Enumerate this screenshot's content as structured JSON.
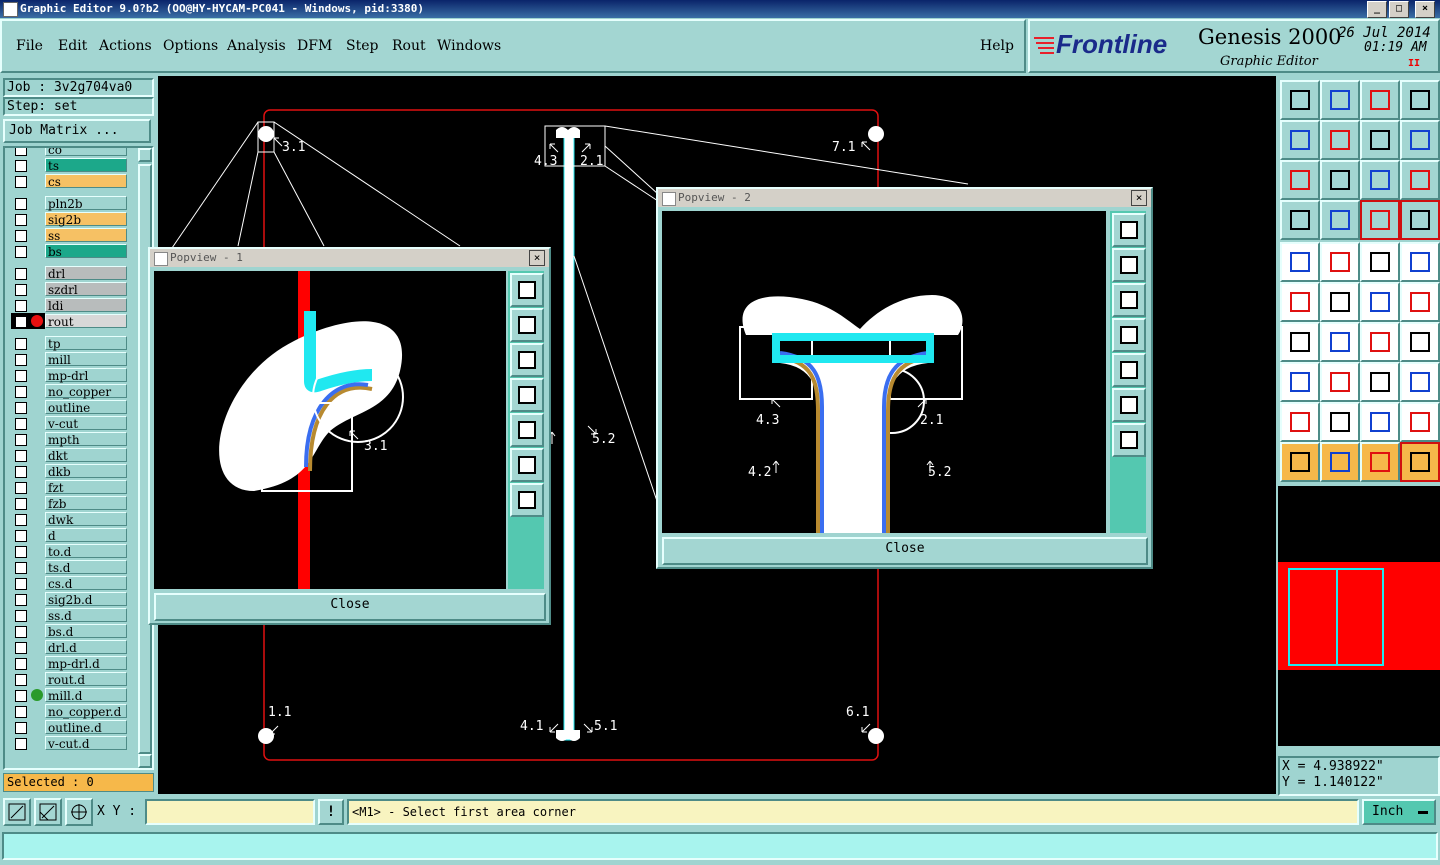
{
  "window": {
    "title": "Graphic Editor 9.0?b2 (OO@HY-HYCAM-PC041 - Windows, pid:3380)",
    "buttons": [
      "_",
      "□",
      "×"
    ]
  },
  "menu": {
    "items": [
      "File",
      "Edit",
      "Actions",
      "Options",
      "Analysis",
      "DFM",
      "Step",
      "Rout",
      "Windows"
    ],
    "help": "Help"
  },
  "brand": {
    "logo": "Frontline",
    "product": "Genesis 2000",
    "subtitle": "Graphic Editor",
    "date": "26 Jul 2014",
    "time": "01:19 AM",
    "indicator": "II"
  },
  "job": {
    "job_label": "Job : 3v2g704va0",
    "step_label": "Step: set",
    "matrix_button": "Job Matrix ..."
  },
  "layers": [
    {
      "name": "co",
      "color": "#9fd4d0"
    },
    {
      "name": "ts",
      "color": "#1ca88a"
    },
    {
      "name": "cs",
      "color": "#f6c164"
    },
    {
      "name": "pln2b",
      "color": "#9fd4d0"
    },
    {
      "name": "sig2b",
      "color": "#f6c164"
    },
    {
      "name": "ss",
      "color": "#f6c164"
    },
    {
      "name": "bs",
      "color": "#1ca88a"
    },
    {
      "name": "drl",
      "color": "#b8bcbc"
    },
    {
      "name": "szdrl",
      "color": "#b8bcbc"
    },
    {
      "name": "ldi",
      "color": "#b8bcbc"
    },
    {
      "name": "rout",
      "color": "#d8d8d8"
    },
    {
      "name": "tp",
      "color": "#9fd4d0"
    },
    {
      "name": "mill",
      "color": "#9fd4d0"
    },
    {
      "name": "mp-drl",
      "color": "#9fd4d0"
    },
    {
      "name": "no_copper",
      "color": "#9fd4d0"
    },
    {
      "name": "outline",
      "color": "#9fd4d0"
    },
    {
      "name": "v-cut",
      "color": "#9fd4d0"
    },
    {
      "name": "mpth",
      "color": "#9fd4d0"
    },
    {
      "name": "dkt",
      "color": "#9fd4d0"
    },
    {
      "name": "dkb",
      "color": "#9fd4d0"
    },
    {
      "name": "fzt",
      "color": "#9fd4d0"
    },
    {
      "name": "fzb",
      "color": "#9fd4d0"
    },
    {
      "name": "dwk",
      "color": "#9fd4d0"
    },
    {
      "name": "d",
      "color": "#9fd4d0"
    },
    {
      "name": "to.d",
      "color": "#9fd4d0"
    },
    {
      "name": "ts.d",
      "color": "#9fd4d0"
    },
    {
      "name": "cs.d",
      "color": "#9fd4d0"
    },
    {
      "name": "sig2b.d",
      "color": "#9fd4d0"
    },
    {
      "name": "ss.d",
      "color": "#9fd4d0"
    },
    {
      "name": "bs.d",
      "color": "#9fd4d0"
    },
    {
      "name": "drl.d",
      "color": "#9fd4d0"
    },
    {
      "name": "mp-drl.d",
      "color": "#9fd4d0"
    },
    {
      "name": "rout.d",
      "color": "#9fd4d0"
    },
    {
      "name": "mill.d",
      "color": "#9fd4d0"
    },
    {
      "name": "no_copper.d",
      "color": "#9fd4d0"
    },
    {
      "name": "outline.d",
      "color": "#9fd4d0"
    },
    {
      "name": "v-cut.d",
      "color": "#9fd4d0"
    }
  ],
  "selected": "Selected : 0",
  "canvas_labels": {
    "l31": "3.1",
    "l43": "4.3",
    "l21": "2.1",
    "l71": "7.1",
    "l52": "5.2",
    "l11": "1.1",
    "l41": "4.1",
    "l51": "5.1",
    "l61": "6.1"
  },
  "popview1": {
    "title": "Popview - 1",
    "label": "3.1",
    "close": "Close"
  },
  "popview2": {
    "title": "Popview - 2",
    "labels": {
      "a": "4.3",
      "b": "2.1",
      "c": "4.2",
      "d": "5.2"
    },
    "close": "Close"
  },
  "coords": {
    "x": "X = 4.938922\"",
    "y": "Y = 1.140122\""
  },
  "status": {
    "xy_label": "X Y :",
    "xy_value": "",
    "warn": "!",
    "message": "<M1> - Select first area corner",
    "units": "Inch"
  },
  "colors": {
    "panel": "#9fd4d0",
    "trace_cyan": "#20e8f0",
    "rout_red": "#ff0000",
    "copper_blue": "#3a6ef0",
    "copper_gold": "#b88a30"
  }
}
